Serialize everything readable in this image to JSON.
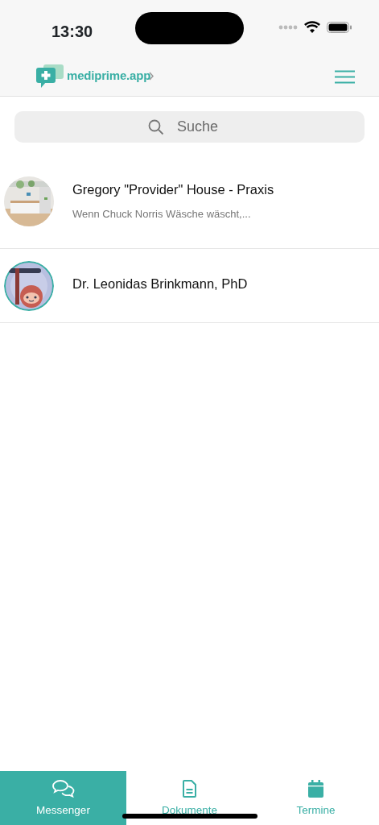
{
  "status_bar": {
    "time": "13:30"
  },
  "header": {
    "logo_text": "mediprime.app"
  },
  "search": {
    "placeholder": "Suche"
  },
  "chats": [
    {
      "name": "Gregory \"Provider\" House - Praxis",
      "preview": "Wenn Chuck Norris Wäsche wäscht,..."
    },
    {
      "name": "Dr. Leonidas Brinkmann, PhD",
      "kind": "illustration"
    }
  ],
  "tabs": [
    {
      "label": "Messenger",
      "kind": "chat",
      "selected": true
    },
    {
      "label": "Dokumente",
      "kind": "document",
      "selected": false
    },
    {
      "label": "Termine",
      "kind": "calendar",
      "selected": false
    }
  ]
}
